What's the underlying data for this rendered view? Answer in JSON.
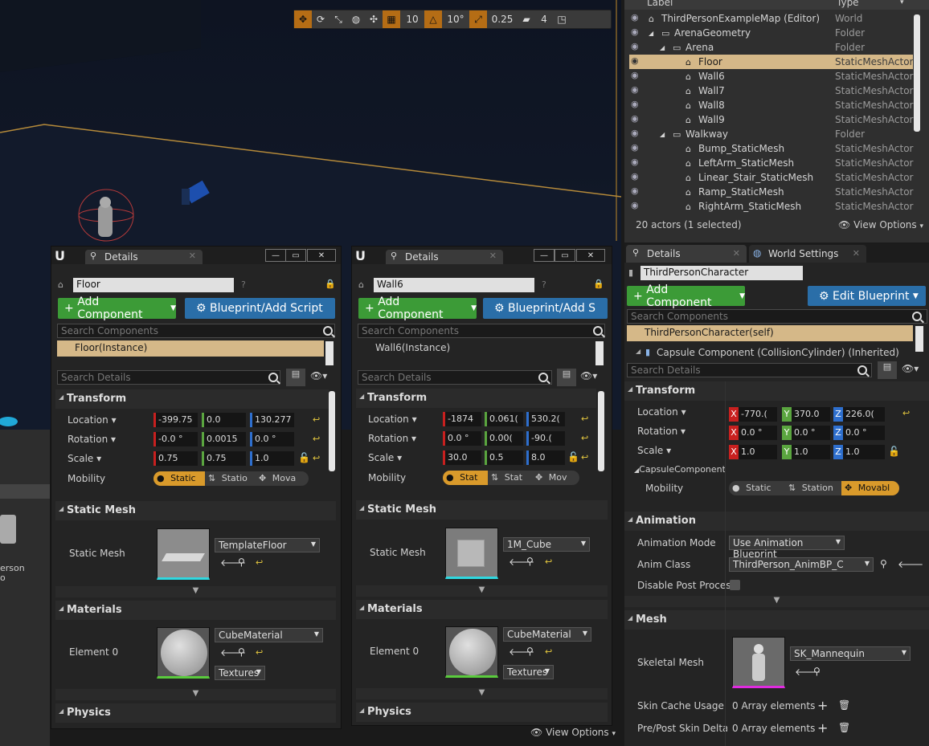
{
  "viewport_toolbar": {
    "grid_snap": "10",
    "angle_snap": "10°",
    "scale_snap": "0.25",
    "camera_speed": "4"
  },
  "lowleft": {
    "label_line1": "erson",
    "label_line2": "o"
  },
  "outliner": {
    "col_label": "Label",
    "col_type": "Type",
    "rows": [
      {
        "label": "ThirdPersonExampleMap (Editor)",
        "type": "World"
      },
      {
        "label": "ArenaGeometry",
        "type": "Folder"
      },
      {
        "label": "Arena",
        "type": "Folder"
      },
      {
        "label": "Floor",
        "type": "StaticMeshActor"
      },
      {
        "label": "Wall6",
        "type": "StaticMeshActor"
      },
      {
        "label": "Wall7",
        "type": "StaticMeshActor"
      },
      {
        "label": "Wall8",
        "type": "StaticMeshActor"
      },
      {
        "label": "Wall9",
        "type": "StaticMeshActor"
      },
      {
        "label": "Walkway",
        "type": "Folder"
      },
      {
        "label": "Bump_StaticMesh",
        "type": "StaticMeshActor"
      },
      {
        "label": "LeftArm_StaticMesh",
        "type": "StaticMeshActor"
      },
      {
        "label": "Linear_Stair_StaticMesh",
        "type": "StaticMeshActor"
      },
      {
        "label": "Ramp_StaticMesh",
        "type": "StaticMeshActor"
      },
      {
        "label": "RightArm_StaticMesh",
        "type": "StaticMeshActor"
      }
    ],
    "status": "20 actors (1 selected)",
    "view_options": "View Options"
  },
  "panel1": {
    "tab": "Details",
    "name": "Floor",
    "add_component": "Add Component",
    "blueprint": "Blueprint/Add Script",
    "search_components": "Search Components",
    "component": "Floor(Instance)",
    "search_details": "Search Details",
    "transform": "Transform",
    "location_label": "Location",
    "rotation_label": "Rotation",
    "scale_label": "Scale",
    "mobility_label": "Mobility",
    "loc": [
      "-399.75",
      "0.0",
      "130.277"
    ],
    "rot": [
      "-0.0 °",
      "0.0015",
      "0.0 °"
    ],
    "scale": [
      "0.75",
      "0.75",
      "1.0"
    ],
    "mobility": [
      "Static",
      "Statio",
      "Mova"
    ],
    "static_mesh_section": "Static Mesh",
    "static_mesh_label": "Static Mesh",
    "mesh": "TemplateFloor",
    "materials_section": "Materials",
    "element_label": "Element 0",
    "material": "CubeMaterial",
    "textures": "Textures",
    "physics": "Physics"
  },
  "panel2": {
    "tab": "Details",
    "name": "Wall6",
    "add_component": "Add Component",
    "blueprint": "Blueprint/Add S",
    "search_components": "Search Components",
    "component": "Wall6(Instance)",
    "search_details": "Search Details",
    "transform": "Transform",
    "location_label": "Location",
    "rotation_label": "Rotation",
    "scale_label": "Scale",
    "mobility_label": "Mobility",
    "loc": [
      "-1874",
      "0.061(",
      "530.2("
    ],
    "rot": [
      "0.0 °",
      "0.00(",
      "-90.("
    ],
    "scale": [
      "30.0",
      "0.5",
      "8.0"
    ],
    "mobility": [
      "Stat",
      "Stat",
      "Mov"
    ],
    "static_mesh_section": "Static Mesh",
    "static_mesh_label": "Static Mesh",
    "mesh": "1M_Cube",
    "materials_section": "Materials",
    "element_label": "Element 0",
    "material": "CubeMaterial",
    "textures": "Textures",
    "physics": "Physics",
    "view_options": "View Options"
  },
  "panel3": {
    "tab_details": "Details",
    "tab_world": "World Settings",
    "name": "ThirdPersonCharacter",
    "add_component": "Add Component",
    "edit_blueprint": "Edit Blueprint",
    "search_components": "Search Components",
    "component_self": "ThirdPersonCharacter(self)",
    "component_capsule": "Capsule Component (CollisionCylinder) (Inherited)",
    "search_details": "Search Details",
    "transform": "Transform",
    "location_label": "Location",
    "rotation_label": "Rotation",
    "scale_label": "Scale",
    "loc": [
      "-770.(",
      "370.0",
      "226.0("
    ],
    "rot": [
      "0.0 °",
      "0.0 °",
      "0.0 °"
    ],
    "scale": [
      "1.0",
      "1.0",
      "1.0"
    ],
    "capsule_label": "CapsuleComponent",
    "mobility_label": "Mobility",
    "mobility": [
      "Static",
      "Station",
      "Movabl"
    ],
    "animation_section": "Animation",
    "anim_mode_label": "Animation Mode",
    "anim_mode": "Use Animation Blueprint",
    "anim_class_label": "Anim Class",
    "anim_class": "ThirdPerson_AnimBP_C",
    "disable_pp_label": "Disable Post Process",
    "mesh_section": "Mesh",
    "skeletal_label": "Skeletal Mesh",
    "skeletal_mesh": "SK_Mannequin",
    "skin_cache_label": "Skin Cache Usage",
    "skin_cache_val": "0 Array elements",
    "pre_post_label": "Pre/Post Skin Deltas i",
    "pre_post_val": "0 Array elements"
  }
}
